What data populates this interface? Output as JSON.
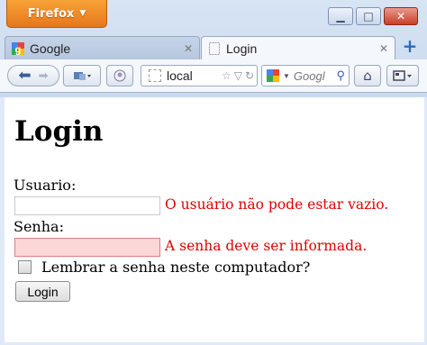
{
  "window": {
    "app_button_label": "Firefox",
    "minimize_glyph": "▁",
    "maximize_glyph": "□",
    "close_glyph": "✕"
  },
  "tabs": [
    {
      "label": "Google",
      "icon": "google-icon",
      "active": false,
      "close_glyph": "✕"
    },
    {
      "label": "Login",
      "icon": "blank-page-icon",
      "active": true,
      "close_glyph": "✕"
    }
  ],
  "new_tab_glyph": "+",
  "navbar": {
    "url": "local",
    "search_placeholder": "Googl",
    "icons": [
      "back-icon",
      "forward-icon",
      "bookmarks-icon",
      "reader-icon",
      "star-icon",
      "reload-icon",
      "search-icon",
      "home-icon",
      "menu-icon"
    ]
  },
  "page": {
    "title": "Login",
    "username_label": "Usuario:",
    "username_value": "",
    "username_error": "O usuário não pode estar vazio.",
    "password_label": "Senha:",
    "password_value": "",
    "password_error": "A senha deve ser informada.",
    "remember_label": "Lembrar a senha neste computador?",
    "remember_checked": false,
    "submit_label": "Login"
  },
  "colors": {
    "firefox_orange": "#e6761d",
    "error_red": "#e00000",
    "error_field_bg": "#fbd8d8"
  }
}
